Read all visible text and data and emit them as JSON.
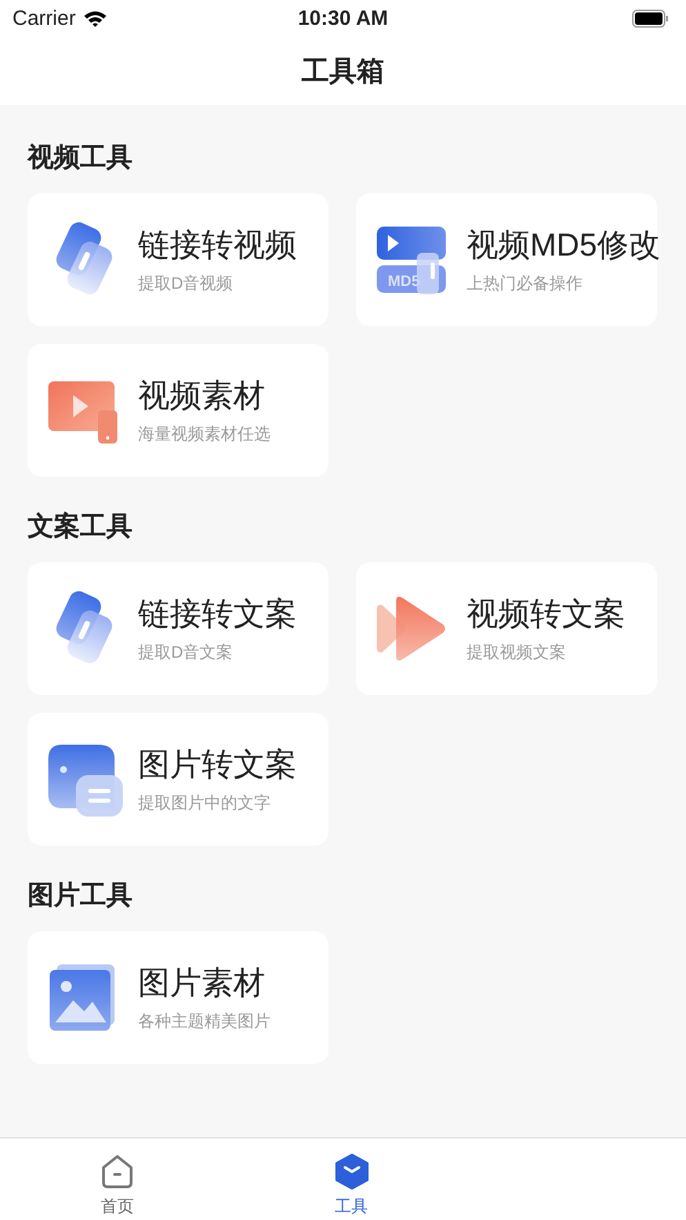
{
  "status_bar": {
    "carrier": "Carrier",
    "time": "10:30 AM"
  },
  "nav": {
    "title": "工具箱"
  },
  "sections": [
    {
      "title": "视频工具",
      "tools": [
        {
          "kind": "link",
          "title": "链接转视频",
          "subtitle": "提取D音视频"
        },
        {
          "kind": "md5",
          "title": "视频MD5修改",
          "subtitle": "上热门必备操作",
          "icon_label": "MD5"
        },
        {
          "kind": "video-material",
          "title": "视频素材",
          "subtitle": "海量视频素材任选"
        }
      ]
    },
    {
      "title": "文案工具",
      "tools": [
        {
          "kind": "link",
          "title": "链接转文案",
          "subtitle": "提取D音文案"
        },
        {
          "kind": "play",
          "title": "视频转文案",
          "subtitle": "提取视频文案"
        },
        {
          "kind": "image-text",
          "title": "图片转文案",
          "subtitle": "提取图片中的文字"
        }
      ]
    },
    {
      "title": "图片工具",
      "tools": [
        {
          "kind": "picture-material",
          "title": "图片素材",
          "subtitle": "各种主题精美图片"
        }
      ]
    }
  ],
  "tabs": [
    {
      "kind": "home",
      "label": "首页",
      "selected": false
    },
    {
      "kind": "tools",
      "label": "工具",
      "selected": true
    }
  ]
}
